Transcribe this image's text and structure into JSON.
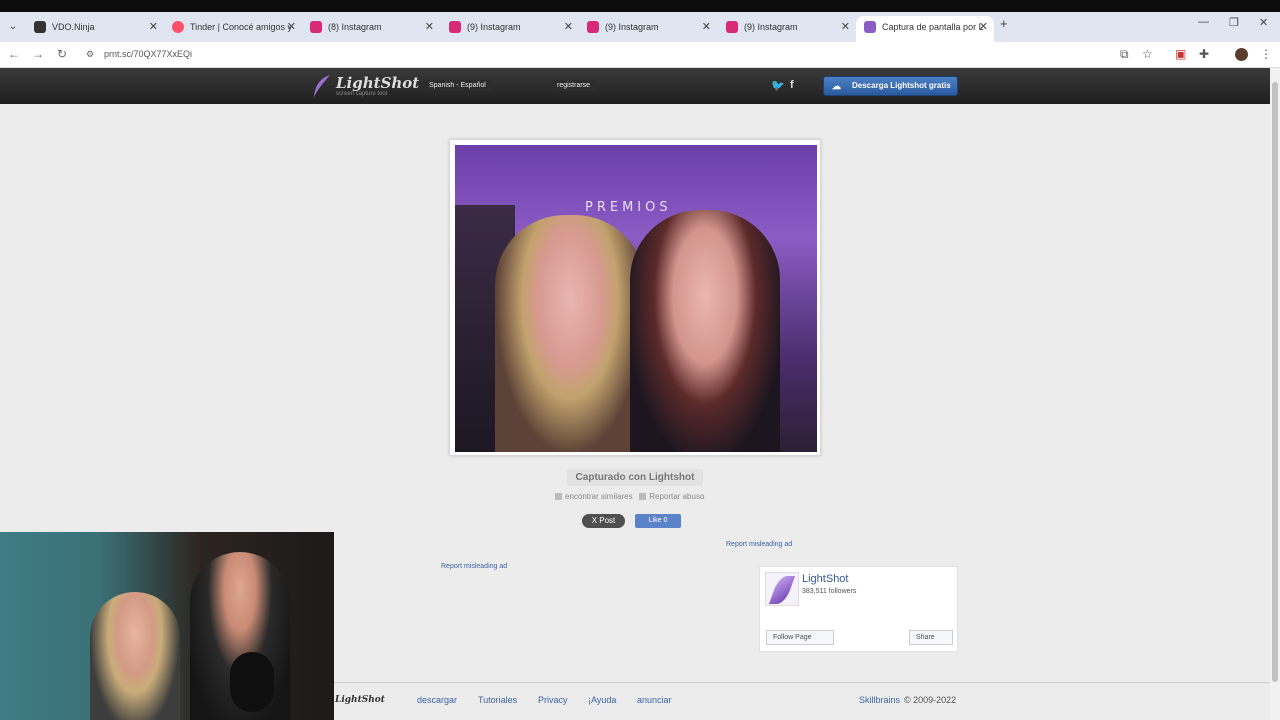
{
  "browser": {
    "tabs": [
      {
        "label": "VDO.Ninja",
        "color": "#333333"
      },
      {
        "label": "Tinder | Conocé amigos y",
        "color": "#fd5068"
      },
      {
        "label": "(8) Instagram",
        "color": "#d62976"
      },
      {
        "label": "(9) Instagram",
        "color": "#d62976"
      },
      {
        "label": "(9) Instagram",
        "color": "#d62976"
      },
      {
        "label": "(9) Instagram",
        "color": "#d62976"
      },
      {
        "label": "Captura de pantalla por L",
        "color": "#8a5cc5"
      }
    ],
    "url": "prnt.sc/70QX77XxEQi"
  },
  "lightshot": {
    "logo_name": "LightShot",
    "logo_tag": "screen capture tool",
    "language": "Spanish - Español",
    "register": "registrarse",
    "download_button": "Descarga Lightshot gratis",
    "screenshot_banner": "PREMIOS",
    "caption": "Capturado con Lightshot",
    "find_similar": "encontrar similares",
    "report_abuse": "Reportar abuso",
    "x_post": "X Post",
    "fb_like": "Like 0",
    "report_ad_1": "Report misleading ad",
    "report_ad_2": "Report misleading ad",
    "fb_page": {
      "title": "LightShot",
      "followers": "383,511 followers",
      "follow": "Follow Page",
      "share": "Share"
    },
    "footer": {
      "logo": "LightShot",
      "links": [
        "descargar",
        "Tutoriales",
        "Privacy",
        "¡Ayuda",
        "anunciar"
      ],
      "skillbrains": "Skillbrains",
      "copyright": "© 2009-2022"
    }
  }
}
